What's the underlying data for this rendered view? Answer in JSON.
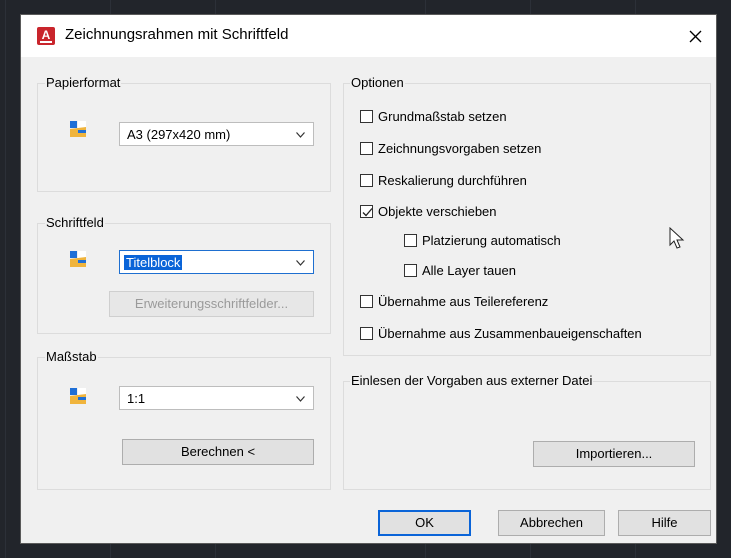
{
  "dialog": {
    "title": "Zeichnungsrahmen mit Schriftfeld",
    "app_icon_letter": "A"
  },
  "papierformat": {
    "label": "Papierformat",
    "selected": "A3 (297x420 mm)"
  },
  "schriftfeld": {
    "label": "Schriftfeld",
    "selected": "Titelblock",
    "extensions_button": "Erweiterungsschriftfelder..."
  },
  "massstab": {
    "label": "Maßstab",
    "selected": "1:1",
    "compute_button": "Berechnen <"
  },
  "optionen": {
    "label": "Optionen",
    "items": [
      {
        "label": "Grundmaßstab setzen",
        "checked": false
      },
      {
        "label": "Zeichnungsvorgaben setzen",
        "checked": false
      },
      {
        "label": "Reskalierung durchführen",
        "checked": false
      },
      {
        "label": "Objekte verschieben",
        "checked": true
      },
      {
        "label": "Platzierung automatisch",
        "checked": false
      },
      {
        "label": "Alle Layer tauen",
        "checked": false
      },
      {
        "label": "Übernahme aus Teilereferenz",
        "checked": false
      },
      {
        "label": "Übernahme aus Zusammenbaueigenschaften",
        "checked": false
      }
    ]
  },
  "import_group": {
    "label": "Einlesen der Vorgaben aus externer Datei",
    "import_button": "Importieren..."
  },
  "footer": {
    "ok": "OK",
    "cancel": "Abbrechen",
    "help": "Hilfe"
  },
  "colors": {
    "accent": "#0a64d8",
    "brand": "#c9252c",
    "dialog_bg": "#f0f0f0"
  }
}
